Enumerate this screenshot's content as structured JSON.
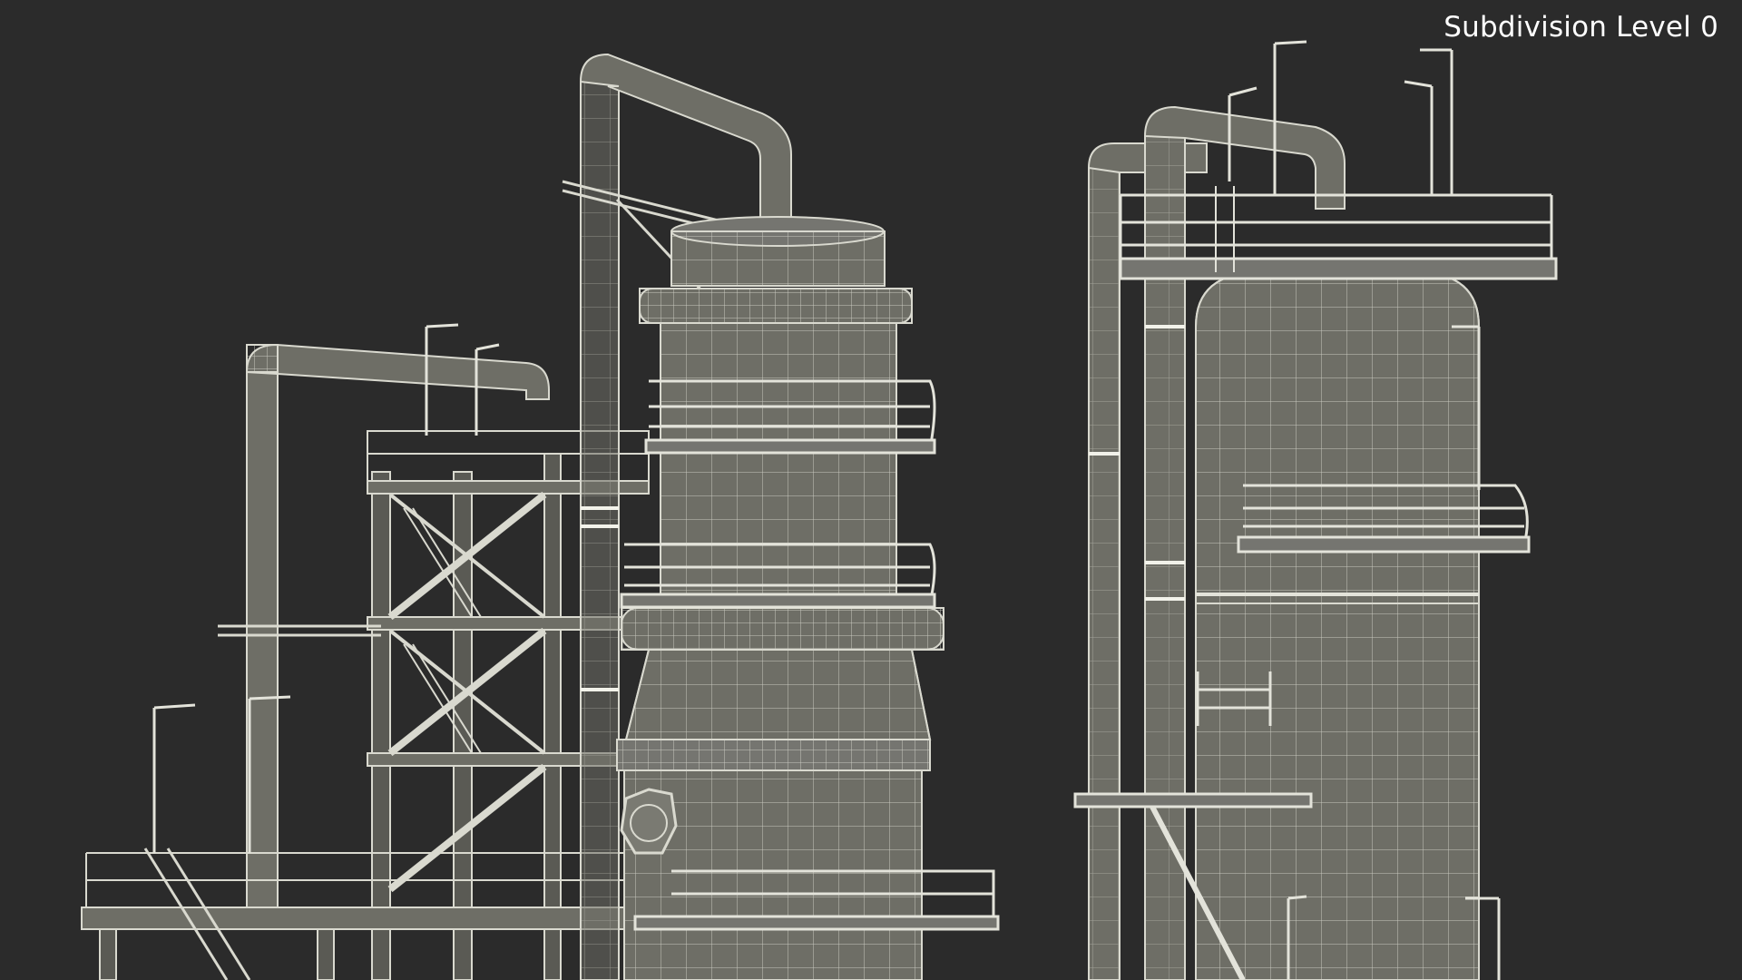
{
  "viewport": {
    "overlay_label": "Subdivision Level 0",
    "background_color": "#2b2b2b",
    "model_fill_color": "#6e6e66",
    "model_fill_dark": "#575750",
    "wire_color": "#d9d9cf",
    "highlight_color": "#f2f2ea"
  }
}
